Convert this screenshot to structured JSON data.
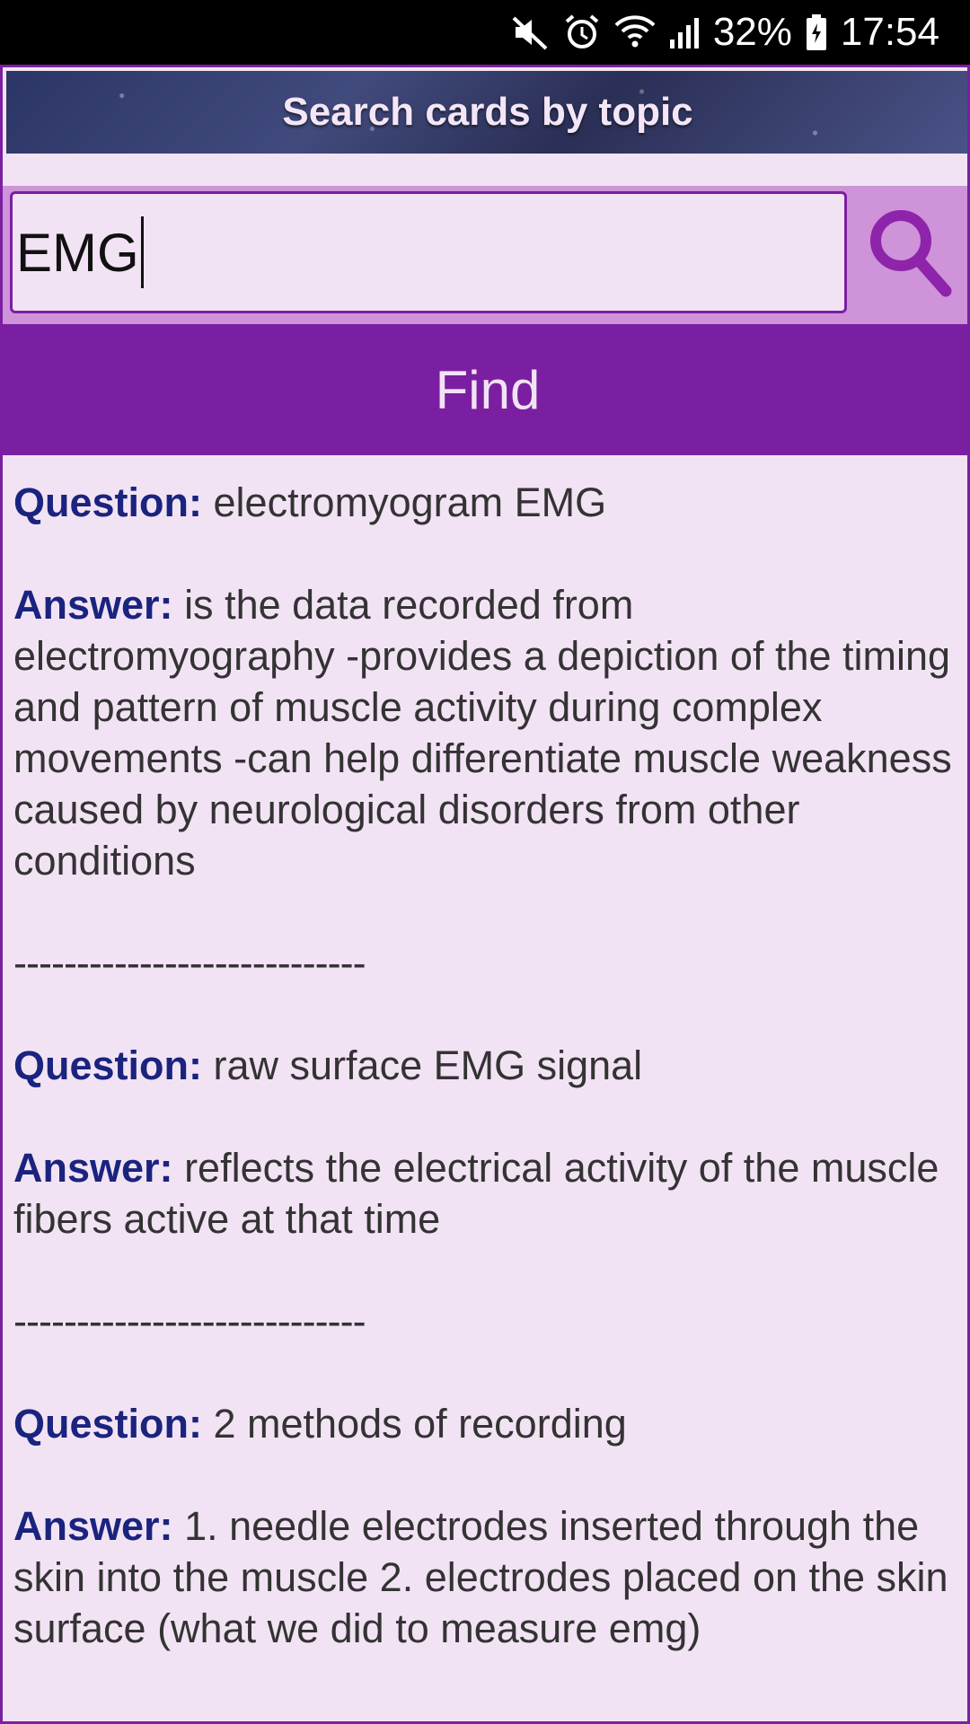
{
  "status_bar": {
    "battery": "32%",
    "time": "17:54"
  },
  "header": {
    "title": "Search cards by topic"
  },
  "search": {
    "value": "EMG",
    "find_label": "Find"
  },
  "labels": {
    "question": "Question:",
    "answer": "Answer:",
    "separator": "----------------------------"
  },
  "cards": [
    {
      "question": "electromyogram EMG",
      "answer": "is the data recorded from electromyography -provides a depiction of the timing and pattern of muscle activity during complex movements -can help differentiate muscle weakness caused by neurological disorders from other conditions"
    },
    {
      "question": "raw surface EMG signal",
      "answer": "reflects the electrical activity of the muscle fibers active at that time"
    },
    {
      "question": "2 methods of recording",
      "answer": "1. needle electrodes inserted through the skin into the muscle 2. electrodes placed on the skin surface (what we did to measure emg)"
    }
  ],
  "colors": {
    "accent": "#7b1fa2",
    "background": "#f2e3f4",
    "search_row": "#ce93d8",
    "label": "#1a237e"
  }
}
